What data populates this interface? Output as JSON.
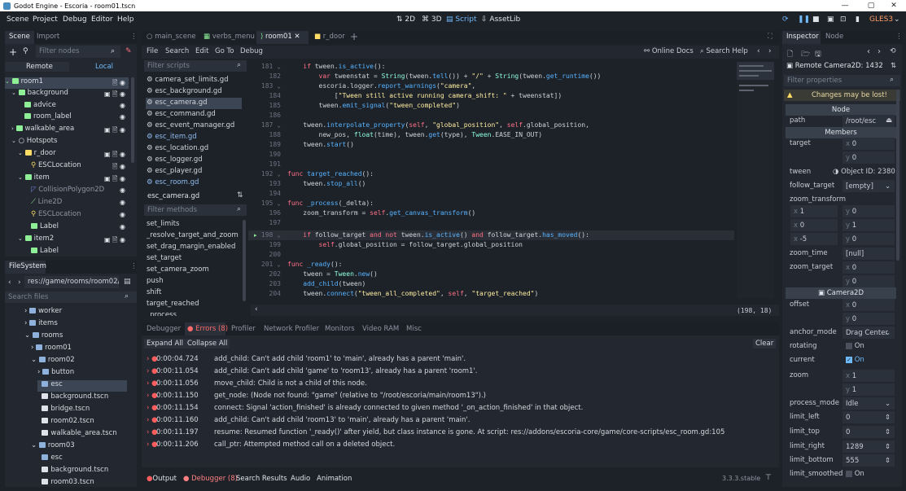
{
  "window": {
    "title": "Godot Engine - Escoria - room01.tscn",
    "min": "—",
    "max": "▢",
    "close": "✕"
  },
  "menubar": {
    "menus": [
      "Scene",
      "Project",
      "Debug",
      "Editor",
      "Help"
    ],
    "workspaces": [
      "2D",
      "3D",
      "Script",
      "AssetLib"
    ],
    "renderer": "GLES3"
  },
  "scene_dock": {
    "tabs": [
      "Scene",
      "Import"
    ],
    "filter_placeholder": "Filter nodes",
    "remote": "Remote",
    "local": "Local",
    "nodes": [
      {
        "label": "room1",
        "color": "#e0e0e0"
      },
      {
        "label": "background",
        "color": "#8eef97"
      },
      {
        "label": "advice",
        "color": "#8eef97"
      },
      {
        "label": "room_label",
        "color": "#8eef97"
      },
      {
        "label": "walkable_area",
        "color": "#8eef97"
      },
      {
        "label": "Hotspots",
        "color": "#e0e0e0"
      },
      {
        "label": "r_door",
        "color": "#ffdd65"
      },
      {
        "label": "ESCLocation",
        "color": "#ffdd65"
      },
      {
        "label": "item",
        "color": "#8eef97"
      },
      {
        "label": "CollisionPolygon2D",
        "color": "#6b7fd8"
      },
      {
        "label": "Line2D",
        "color": "#8eef97"
      },
      {
        "label": "ESCLocation",
        "color": "#ffdd65"
      },
      {
        "label": "Label",
        "color": "#8eef97"
      },
      {
        "label": "item2",
        "color": "#8eef97"
      },
      {
        "label": "Label",
        "color": "#8eef97"
      }
    ]
  },
  "filesystem": {
    "title": "FileSystem",
    "path": "res://game/rooms/room02/e",
    "search_placeholder": "Search files",
    "entries": [
      "worker",
      "items",
      "rooms",
      "room01",
      "room02",
      "button",
      "esc",
      "background.tscn",
      "bridge.tscn",
      "room02.tscn",
      "walkable_area.tscn",
      "room03",
      "esc",
      "background.tscn",
      "room03.tscn"
    ]
  },
  "editor_tabs": [
    "main_scene",
    "verbs_menu",
    "room01",
    "r_door"
  ],
  "script_menu": [
    "File",
    "Search",
    "Edit",
    "Go To",
    "Debug"
  ],
  "online_docs": "Online Docs",
  "search_help": "Search Help",
  "scripts": {
    "filter_placeholder": "Filter scripts",
    "files": [
      "camera_set_limits.gd",
      "esc_background.gd",
      "esc_camera.gd",
      "esc_command.gd",
      "esc_event_manager.gd",
      "esc_item.gd",
      "esc_location.gd",
      "esc_logger.gd",
      "esc_player.gd",
      "esc_room.gd"
    ],
    "current": "esc_camera.gd",
    "methods_placeholder": "Filter methods",
    "methods": [
      "set_limits",
      "_resolve_target_and_zoom",
      "set_drag_margin_enabled",
      "set_target",
      "set_camera_zoom",
      "push",
      "shift",
      "target_reached",
      "_process"
    ]
  },
  "code": {
    "cursor": "(198, 18)",
    "lines": [
      {
        "n": "181",
        "t": "    if tween.is_active():"
      },
      {
        "n": "182",
        "t": "        var tweenstat = String(tween.tell()) + \"/\" + String(tween.get_runtime())"
      },
      {
        "n": "183",
        "t": "        escoria.logger.report_warnings(\"camera\","
      },
      {
        "n": "184",
        "t": "            [\"Tween still active running camera_shift: \" + tweenstat])"
      },
      {
        "n": "185",
        "t": "        tween.emit_signal(\"tween_completed\")"
      },
      {
        "n": "186",
        "t": ""
      },
      {
        "n": "187",
        "t": "    tween.interpolate_property(self, \"global_position\", self.global_position,"
      },
      {
        "n": "188",
        "t": "        new_pos, float(time), tween.get(type), Tween.EASE_IN_OUT)"
      },
      {
        "n": "189",
        "t": "    tween.start()"
      },
      {
        "n": "190",
        "t": ""
      },
      {
        "n": "191",
        "t": ""
      },
      {
        "n": "192",
        "t": "func target_reached():"
      },
      {
        "n": "193",
        "t": "    tween.stop_all()"
      },
      {
        "n": "194",
        "t": ""
      },
      {
        "n": "195",
        "t": "func _process(_delta):"
      },
      {
        "n": "196",
        "t": "    zoom_transform = self.get_canvas_transform()"
      },
      {
        "n": "197",
        "t": ""
      },
      {
        "n": "198",
        "t": "    if follow_target and not tween.is_active() and follow_target.has_moved():"
      },
      {
        "n": "199",
        "t": "        self.global_position = follow_target.global_position"
      },
      {
        "n": "200",
        "t": ""
      },
      {
        "n": "201",
        "t": "func _ready():"
      },
      {
        "n": "202",
        "t": "    tween = Tween.new()"
      },
      {
        "n": "203",
        "t": "    add_child(tween)"
      },
      {
        "n": "204",
        "t": "    tween.connect(\"tween_all_completed\", self, \"target_reached\")"
      }
    ]
  },
  "debugger": {
    "tabs": [
      "Debugger",
      "Errors (8)",
      "Profiler",
      "Network Profiler",
      "Monitors",
      "Video RAM",
      "Misc"
    ],
    "expand_all": "Expand All",
    "collapse_all": "Collapse All",
    "clear": "Clear",
    "errors": [
      {
        "time": "0:00:04.724",
        "msg": "add_child: Can't add child 'room1' to 'main', already has a parent 'main'."
      },
      {
        "time": "0:00:11.054",
        "msg": "add_child: Can't add child 'game' to 'room13', already has a parent 'room1'."
      },
      {
        "time": "0:00:11.056",
        "msg": "move_child: Child is not a child of this node."
      },
      {
        "time": "0:00:11.150",
        "msg": "get_node: (Node not found: \"game\" (relative to \"/root/escoria/main/room13\").)"
      },
      {
        "time": "0:00:11.154",
        "msg": "connect: Signal 'action_finished' is already connected to given method '_on_action_finished' in that object."
      },
      {
        "time": "0:00:11.160",
        "msg": "add_child: Can't add child 'room13' to 'main', already has a parent 'main'."
      },
      {
        "time": "0:00:11.197",
        "msg": "resume: Resumed function '_ready()' after yield, but class instance is gone. At script: res://addons/escoria-core/game/core-scripts/esc_room.gd:105"
      },
      {
        "time": "0:00:11.206",
        "msg": "call_ptr: Attempted method call on a deleted object."
      }
    ]
  },
  "bottom_bar": {
    "tabs": [
      "Output",
      "Debugger (8)",
      "Search Results",
      "Audio",
      "Animation"
    ],
    "version": "3.3.3.stable"
  },
  "inspector": {
    "tabs": [
      "Inspector",
      "Node"
    ],
    "object": "Remote Camera2D: 1432",
    "filter_placeholder": "Filter properties",
    "warning": "Changes may be lost!",
    "node_section": "Node",
    "path_label": "path",
    "path_value": "/root/esc",
    "members_section": "Members",
    "target_label": "target",
    "target_x": "0",
    "target_y": "0",
    "tween_label": "tween",
    "tween_value": "Object ID: 2380",
    "follow_target_label": "follow_target",
    "follow_target_value": "[empty]",
    "zoom_transform_label": "zoom_transform",
    "zt": [
      "1",
      "0",
      "0",
      "1",
      "-5",
      "0"
    ],
    "zoom_time_label": "zoom_time",
    "zoom_time_value": "[null]",
    "zoom_target_label": "zoom_target",
    "zoom_target_x": "0",
    "zoom_target_y": "0",
    "camera2d_section": "Camera2D",
    "offset_label": "offset",
    "offset_x": "0",
    "offset_y": "0",
    "anchor_mode_label": "anchor_mode",
    "anchor_mode_value": "Drag Center",
    "rotating_label": "rotating",
    "rotating_value": "On",
    "current_label": "current",
    "current_value": "On",
    "zoom_label": "zoom",
    "zoom_x": "1",
    "zoom_y": "1",
    "process_mode_label": "process_mode",
    "process_mode_value": "Idle",
    "limit_left_label": "limit_left",
    "limit_left_value": "0",
    "limit_top_label": "limit_top",
    "limit_top_value": "0",
    "limit_right_label": "limit_right",
    "limit_right_value": "1289",
    "limit_bottom_label": "limit_bottom",
    "limit_bottom_value": "555",
    "limit_smoothed_label": "limit_smoothed",
    "limit_smoothed_value": "On"
  },
  "colors": {
    "accent": "#70bafa",
    "error": "#ff5d5d",
    "panel": "#232830",
    "background": "#1d2229"
  }
}
